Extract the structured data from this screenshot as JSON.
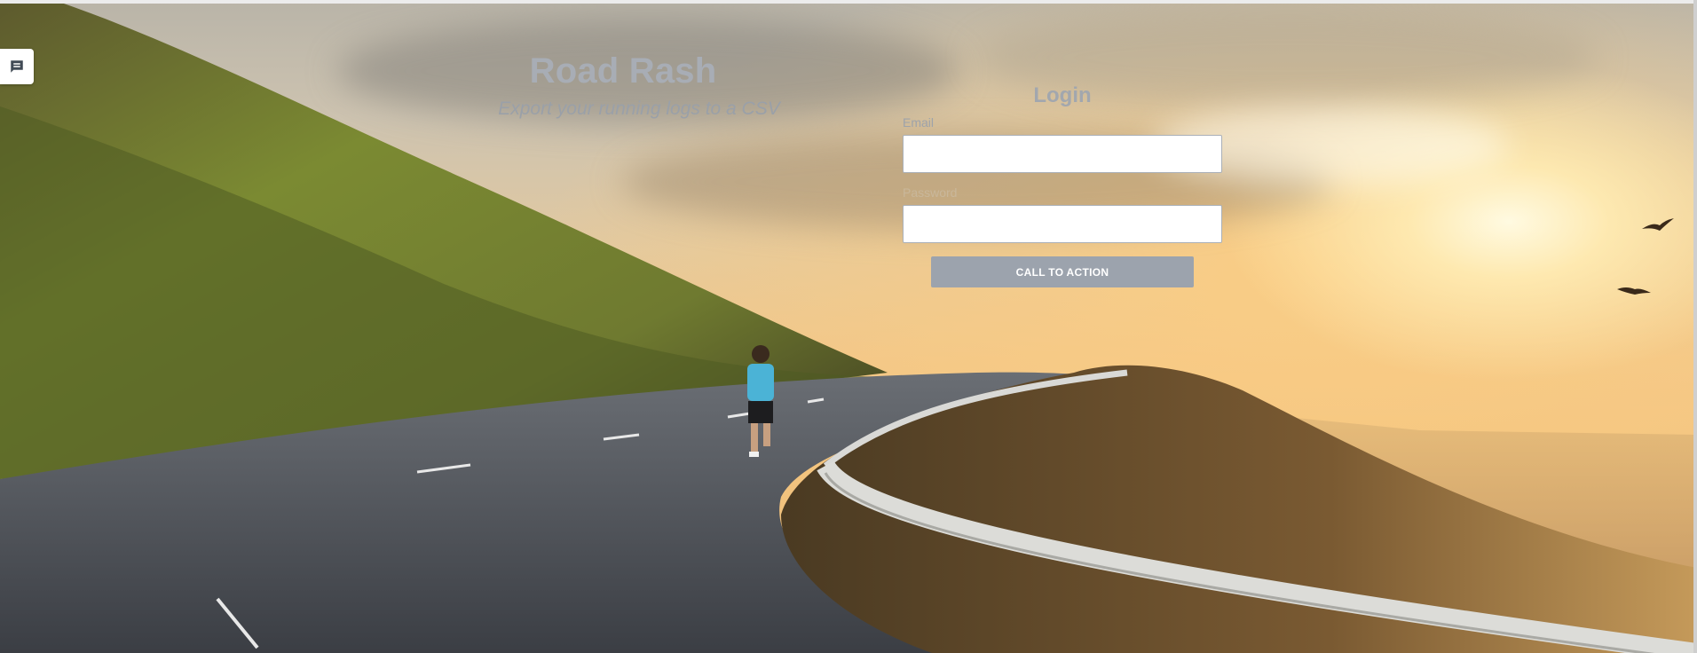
{
  "hero": {
    "title": "Road Rash",
    "subtitle": "Export your running logs to a CSV"
  },
  "login": {
    "heading": "Login",
    "email_label": "Email",
    "email_value": "",
    "password_label": "Password",
    "password_value": "",
    "cta_label": "CALL TO ACTION"
  },
  "widgets": {
    "chat_icon": "chat-bubble-icon"
  },
  "colors": {
    "title": "#a8adb5",
    "cta_bg": "#9ca3ad",
    "cta_text": "#ffffff"
  }
}
